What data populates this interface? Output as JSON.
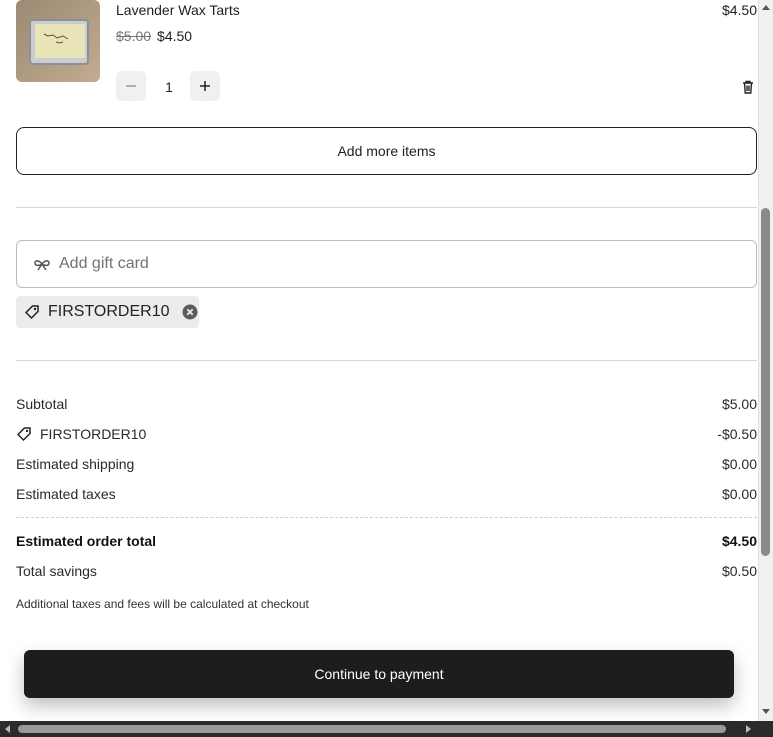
{
  "item": {
    "name": "Lavender Wax Tarts",
    "line_total": "$4.50",
    "original_price": "$5.00",
    "sale_price": "$4.50",
    "quantity": "1",
    "minus_icon": "minus-icon",
    "plus_icon": "plus-icon",
    "delete_icon": "trash-icon"
  },
  "cart": {
    "add_more_label": "Add more items"
  },
  "gift_card": {
    "placeholder": "Add gift card",
    "icon": "gift-bow-icon"
  },
  "applied_discount": {
    "code": "FIRSTORDER10",
    "icon": "tag-icon",
    "remove_icon": "close-circle-icon"
  },
  "summary": {
    "subtotal_label": "Subtotal",
    "subtotal_value": "$5.00",
    "discount_label": "FIRSTORDER10",
    "discount_value": "-$0.50",
    "shipping_label": "Estimated shipping",
    "shipping_value": "$0.00",
    "taxes_label": "Estimated taxes",
    "taxes_value": "$0.00",
    "total_label": "Estimated order total",
    "total_value": "$4.50",
    "savings_label": "Total savings",
    "savings_value": "$0.50",
    "note": "Additional taxes and fees will be calculated at checkout"
  },
  "checkout": {
    "button_label": "Continue to payment"
  },
  "colors": {
    "primary_button": "#1d1d1d",
    "chip_background": "#ececec"
  }
}
